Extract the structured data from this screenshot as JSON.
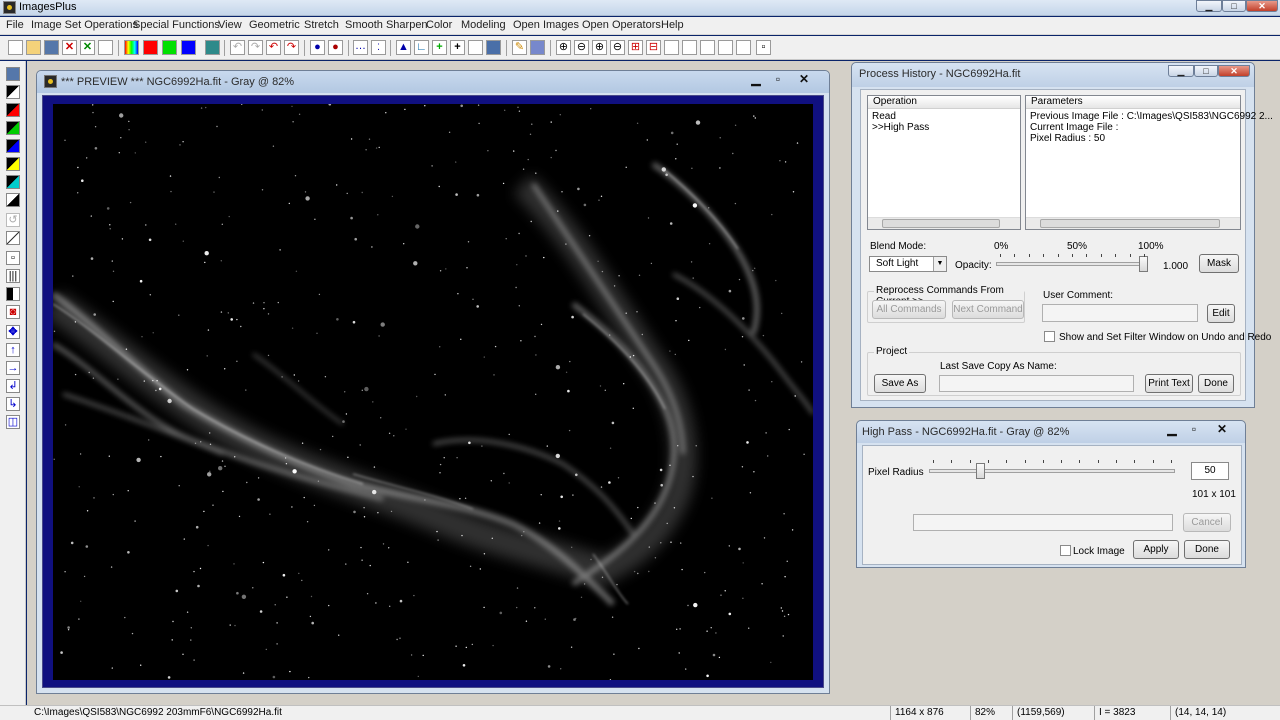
{
  "app": {
    "title": "ImagesPlus"
  },
  "menu": [
    "File",
    "Image Set Operations",
    "Special Functions",
    "View",
    "Geometric",
    "Stretch",
    "Smooth Sharpen",
    "Color",
    "Modeling",
    "Open Images",
    "Open Operators",
    "Help"
  ],
  "toolbar_colors": {
    "red": "#ff0000",
    "green": "#00e000",
    "blue": "#0000ff",
    "accent": "#0a246a"
  },
  "preview": {
    "title": "*** PREVIEW *** NGC6992Ha.fit - Gray @ 82%"
  },
  "process_history": {
    "title": "Process History - NGC6992Ha.fit",
    "operation_header": "Operation",
    "operations": [
      "Read",
      ">>High Pass"
    ],
    "parameters_header": "Parameters",
    "parameters": [
      "Previous Image File : C:\\Images\\QSI583\\NGC6992 2...",
      "Current Image File :",
      "Pixel Radius : 50"
    ],
    "blend_mode_label": "Blend Mode:",
    "blend_mode_value": "Soft Light",
    "opacity_label": "Opacity:",
    "opacity_0": "0%",
    "opacity_50": "50%",
    "opacity_100": "100%",
    "opacity_value": "1.000",
    "opacity_fraction": 1.0,
    "mask_button": "Mask",
    "reprocess_label": "Reprocess Commands From Current >>",
    "all_commands_button": "All Commands",
    "next_command_button": "Next Command",
    "user_comment_label": "User Comment:",
    "edit_button": "Edit",
    "show_filter_label": "Show and Set Filter Window on Undo and Redo",
    "project_label": "Project",
    "last_save_label": "Last Save Copy As Name:",
    "save_as_button": "Save As",
    "print_text_button": "Print Text",
    "done_button": "Done"
  },
  "high_pass": {
    "title": "High Pass - NGC6992Ha.fit - Gray @ 82%",
    "pixel_radius_label": "Pixel Radius",
    "pixel_radius_value": "50",
    "kernel_size": "101 x 101",
    "slider_fraction": 0.2,
    "cancel_button": "Cancel",
    "lock_image_label": "Lock Image",
    "apply_button": "Apply",
    "done_button": "Done"
  },
  "status": {
    "path": "C:\\Images\\QSI583\\NGC6992 203mmF6\\NGC6992Ha.fit",
    "dimensions": "1164 x 876",
    "zoom": "82%",
    "coords": "(1159,569)",
    "intensity": "I = 3823",
    "rgb": "(14, 14, 14)"
  }
}
